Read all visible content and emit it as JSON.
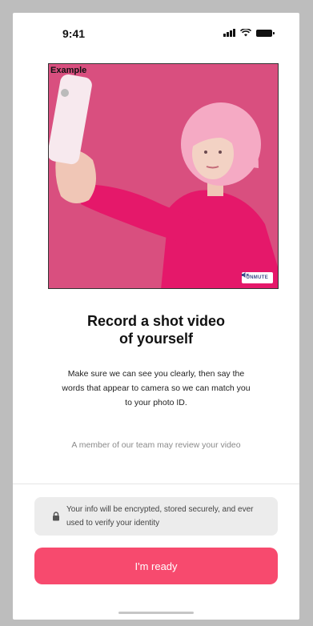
{
  "status_bar": {
    "time": "9:41",
    "icons": [
      "cellular-signal-icon",
      "wifi-icon",
      "battery-icon"
    ]
  },
  "video": {
    "label": "Example",
    "unmute_label": "UNMUTE",
    "unmute_icon": "speaker-muted-icon",
    "background_color": "#d94f7f"
  },
  "content": {
    "title_line1": "Record a shot video",
    "title_line2": "of yourself",
    "description": "Make sure we can see you clearly, then say the words that appear to camera so we can match you to your photo ID.",
    "review_note": "A member of our team may review your video"
  },
  "info_box": {
    "icon": "lock-icon",
    "text": "Your info will be encrypted, stored securely, and ever used to verify your identity"
  },
  "actions": {
    "ready_label": "I'm ready",
    "ready_color": "#f74a6e"
  }
}
